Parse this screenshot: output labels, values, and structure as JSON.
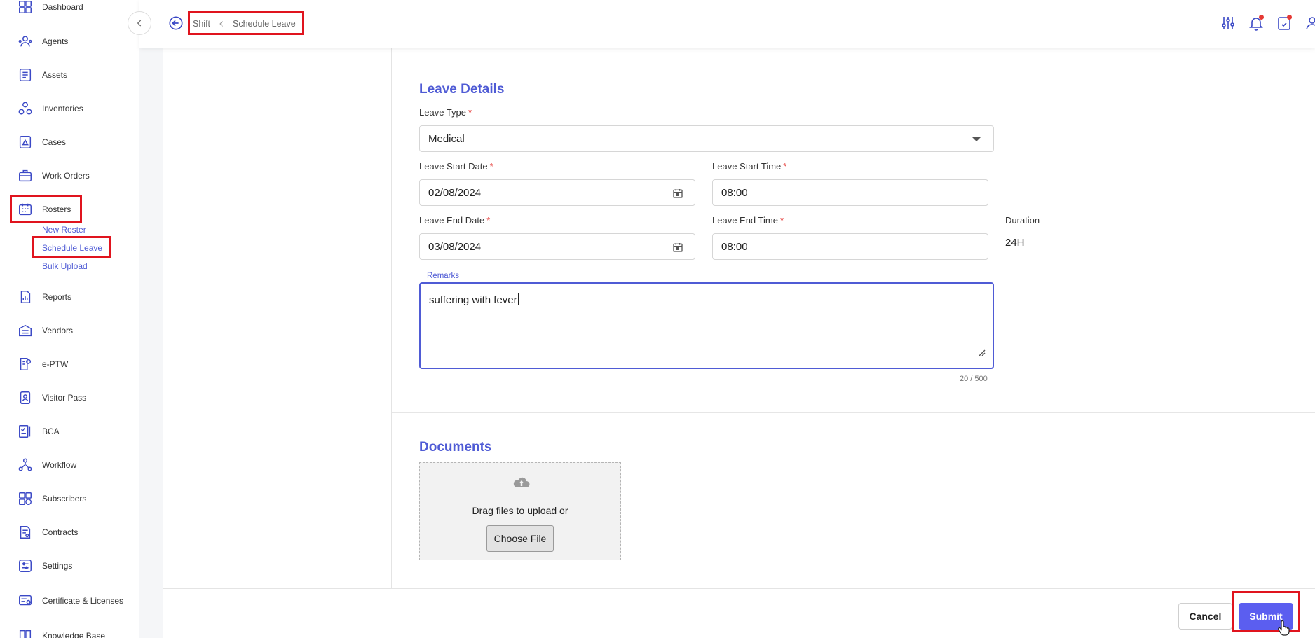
{
  "sidebar": {
    "items": [
      {
        "label": "Dashboard",
        "icon": "dashboard-icon"
      },
      {
        "label": "Agents",
        "icon": "agents-icon"
      },
      {
        "label": "Assets",
        "icon": "assets-icon"
      },
      {
        "label": "Inventories",
        "icon": "inventories-icon"
      },
      {
        "label": "Cases",
        "icon": "cases-icon"
      },
      {
        "label": "Work Orders",
        "icon": "work-orders-icon"
      },
      {
        "label": "Rosters",
        "icon": "rosters-icon"
      },
      {
        "label": "Reports",
        "icon": "reports-icon"
      },
      {
        "label": "Vendors",
        "icon": "vendors-icon"
      },
      {
        "label": "e-PTW",
        "icon": "eptw-icon"
      },
      {
        "label": "Visitor Pass",
        "icon": "visitor-pass-icon"
      },
      {
        "label": "BCA",
        "icon": "bca-icon"
      },
      {
        "label": "Workflow",
        "icon": "workflow-icon"
      },
      {
        "label": "Subscribers",
        "icon": "subscribers-icon"
      },
      {
        "label": "Contracts",
        "icon": "contracts-icon"
      },
      {
        "label": "Settings",
        "icon": "settings-icon"
      },
      {
        "label": "Certificate & Licenses",
        "icon": "certificate-icon"
      },
      {
        "label": "Knowledge Base",
        "icon": "knowledge-icon"
      }
    ],
    "rosters_sub": [
      {
        "label": "New Roster"
      },
      {
        "label": "Schedule Leave"
      },
      {
        "label": "Bulk Upload"
      }
    ]
  },
  "breadcrumb": {
    "parent": "Shift",
    "current": "Schedule Leave"
  },
  "form": {
    "section_title": "Leave Details",
    "leave_type": {
      "label": "Leave Type",
      "value": "Medical"
    },
    "start_date": {
      "label": "Leave Start Date",
      "value": "02/08/2024"
    },
    "start_time": {
      "label": "Leave Start Time",
      "value": "08:00"
    },
    "end_date": {
      "label": "Leave End Date",
      "value": "03/08/2024"
    },
    "end_time": {
      "label": "Leave End Time",
      "value": "08:00"
    },
    "duration": {
      "label": "Duration",
      "value": "24H"
    },
    "remarks": {
      "label": "Remarks",
      "value": "suffering with fever",
      "counter": "20 / 500"
    },
    "required_mark": "*"
  },
  "documents": {
    "title": "Documents",
    "drag_text": "Drag files to upload or",
    "choose_label": "Choose File"
  },
  "footer": {
    "cancel_label": "Cancel",
    "submit_label": "Submit"
  },
  "colors": {
    "accent": "#4f5bd5",
    "submit": "#5b5ef0",
    "highlight": "#e0141e"
  }
}
